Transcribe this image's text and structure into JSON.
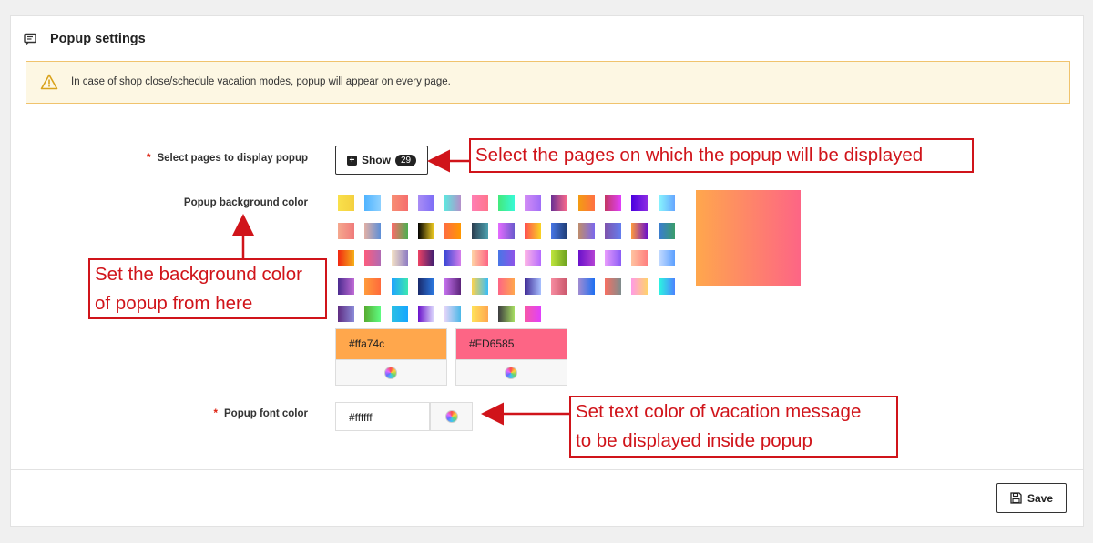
{
  "panel": {
    "title": "Popup settings",
    "notice": "In case of shop close/schedule vacation modes, popup will appear on every page."
  },
  "form": {
    "select_pages_label": "Select pages to display popup",
    "show_label": "Show",
    "show_count": "29",
    "bg_color_label": "Popup background color",
    "gradient_start": "#ffa74c",
    "gradient_end": "#FD6585",
    "font_color_label": "Popup font color",
    "font_color_value": "#ffffff"
  },
  "footer": {
    "save_label": "Save"
  },
  "annotations": {
    "pages": "Select the pages on which the popup will be displayed",
    "bg_line1": "Set the background color",
    "bg_line2": "of popup from here",
    "font_line1": "Set text color of vacation message",
    "font_line2": "to be displayed inside popup"
  },
  "icons": [
    "message-icon",
    "warning-icon",
    "plus-icon",
    "color-wheel-icon",
    "save-icon"
  ],
  "colors": {
    "required": "#dd2211",
    "notice_bg": "#fdf7e3",
    "notice_border": "#f0c36d",
    "annotation": "#d0141a"
  },
  "swatch_gradients": [
    [
      "#f9e04b",
      "#f4d03f"
    ],
    [
      "#4fb3ff",
      "#8ed1ff"
    ],
    [
      "#f78f74",
      "#f66d6d"
    ],
    [
      "#a98df5",
      "#7b6cf6"
    ],
    [
      "#5ee7df",
      "#b490ca"
    ],
    [
      "#ff7eb3",
      "#ff758c"
    ],
    [
      "#43e97b",
      "#38f9d7"
    ],
    [
      "#d38cf5",
      "#a06ef7"
    ],
    [
      "#6a3093",
      "#ff6b8b"
    ],
    [
      "#f39c12",
      "#ff7043"
    ],
    [
      "#c33764",
      "#e040fb"
    ],
    [
      "#4a00e0",
      "#8e2de2"
    ],
    [
      "#89f7fe",
      "#66a6ff"
    ],
    [
      "#f5a88e",
      "#f07b7b"
    ],
    [
      "#e2b0a5",
      "#5d8fd8"
    ],
    [
      "#ff6b6b",
      "#4caf50"
    ],
    [
      "#000000",
      "#f9d423"
    ],
    [
      "#ff6e40",
      "#ff9800"
    ],
    [
      "#2c3e50",
      "#4ca1af"
    ],
    [
      "#e56bff",
      "#6a5acd"
    ],
    [
      "#ff4e50",
      "#f9d423"
    ],
    [
      "#4776e6",
      "#1e3c72"
    ],
    [
      "#bf8d6b",
      "#7b68ee"
    ],
    [
      "#7f53ac",
      "#647dee"
    ],
    [
      "#ff9a3c",
      "#6a11cb"
    ],
    [
      "#3a7bd5",
      "#3a9d6a"
    ],
    [
      "#f12711",
      "#f5af19"
    ],
    [
      "#fc5c7d",
      "#b06ab3"
    ],
    [
      "#f5e3c6",
      "#8e7cc3"
    ],
    [
      "#ed4264",
      "#3a1c71"
    ],
    [
      "#3a47d5",
      "#d57eeb"
    ],
    [
      "#ffd3a5",
      "#fd6585"
    ],
    [
      "#4776e6",
      "#8e54e9"
    ],
    [
      "#ffb6e6",
      "#b56bff"
    ],
    [
      "#bfe53d",
      "#6ba01e"
    ],
    [
      "#6a11cb",
      "#b443d4"
    ],
    [
      "#e89bfc",
      "#8b5cf6"
    ],
    [
      "#ffc3a0",
      "#ff7f7f"
    ],
    [
      "#c6dcff",
      "#5ca0ff"
    ],
    [
      "#4b2b8f",
      "#c06bd6"
    ],
    [
      "#ff9b3b",
      "#ff6a3b"
    ],
    [
      "#1fa2ff",
      "#3be8b0"
    ],
    [
      "#1a2a6c",
      "#2c7be5"
    ],
    [
      "#c471ed",
      "#5b247a"
    ],
    [
      "#fcd34d",
      "#38bdf8"
    ],
    [
      "#fd6585",
      "#ffa74c"
    ],
    [
      "#3f2b96",
      "#a8c0ff"
    ],
    [
      "#f78ca0",
      "#c9566b"
    ],
    [
      "#a18cd1",
      "#1d6ff2"
    ],
    [
      "#f77062",
      "#7f8c8d"
    ],
    [
      "#ff9be6",
      "#ffd36b"
    ],
    [
      "#2afadf",
      "#4c83ff"
    ],
    [
      "#5f2c82",
      "#8b8bd8"
    ],
    [
      "#56ab2f",
      "#5efc82"
    ],
    [
      "#2bc0e4",
      "#17a6ff"
    ],
    [
      "#6a11cb",
      "#e2e2ff"
    ],
    [
      "#e6d5f9",
      "#4bb8e8"
    ],
    [
      "#ffe259",
      "#ffa751"
    ],
    [
      "#3c3b3f",
      "#a8e063"
    ],
    [
      "#f857a6",
      "#e040fb"
    ]
  ]
}
